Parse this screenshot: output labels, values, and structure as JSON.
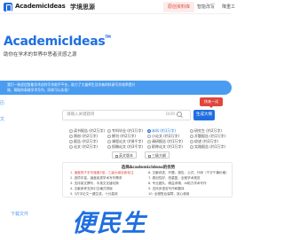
{
  "header": {
    "brand": "AcademicIdeas",
    "brand_cn": "学境思源",
    "nav": [
      "原创资料库",
      "智能改写",
      "降重工"
    ]
  },
  "hero": {
    "title": "AcademicIdeas",
    "trademark": "TM",
    "subtitle": "助你在学术的世界中思者灵感之源"
  },
  "notice": {
    "line1": "我们一致坚信智能学术创作写作助手平台，助力了大量师生及学者的科研写作效率提升",
    "line2": "效，帮助你高效学术写作，同样可以实现！"
  },
  "side_labels": [
    "历",
    "文"
  ],
  "search": {
    "placeholder": "请输入关键题目",
    "counter": "0/20",
    "button": "生成大纲",
    "icon": "search-icon"
  },
  "bubble": "快来一试",
  "options": {
    "row1": [
      "读书报告 (约2万字)",
      "专科毕业 (约1万字)",
      "本科 (约1万字)",
      "研究生 (约2万字)",
      "研究生 (约3万字)"
    ],
    "row2": [
      "原创 (约2万字)",
      "期刊 (约2万字)",
      "小论文 (约3万字)",
      "开题报告 (约1万字)",
      "结束报告 (约1万字)"
    ],
    "row3": [
      "报告 (约2万字)",
      "课程论文 (约8千字)",
      "调研报告 (约1万字)",
      "综述 (约3万字)",
      "读书笔记 (约1万字)"
    ],
    "row4": [
      "论文 (约2万字)",
      "投稿论文 (约3千字)",
      "职称论文 (约1万字)",
      "实践报告 (约1万字)",
      "演讲 (约1万字)"
    ],
    "selected": "本科 (约1万字)"
  },
  "tabs": [
    "英文版本",
    "三级大纲"
  ],
  "panel": {
    "title": "选择AcademicIdeas的优势",
    "reasons_left": [
      "1. 速度快于手写速度2倍，三级大纲全新标注",
      "2. 选项丰富，涵盖各类学术写作需求",
      "3. 支持英文撰写，中英文无缝切换",
      "4. 文献参考支持引文格式排版",
      "5. 3万字论文一键生成，十分高效"
    ],
    "reasons_right": [
      "6. 文献综述、开题、报告、公式、代码（千字千篇价格）",
      "7. 原创性好，低重复，全程学术规范",
      "8. 专业团队，精益求精，AI助力学术写作",
      "9. 支持多语言写作和翻译",
      "10. 全程售后保障，放心使用"
    ]
  },
  "download": "下载文件",
  "watermark": "便民生"
}
